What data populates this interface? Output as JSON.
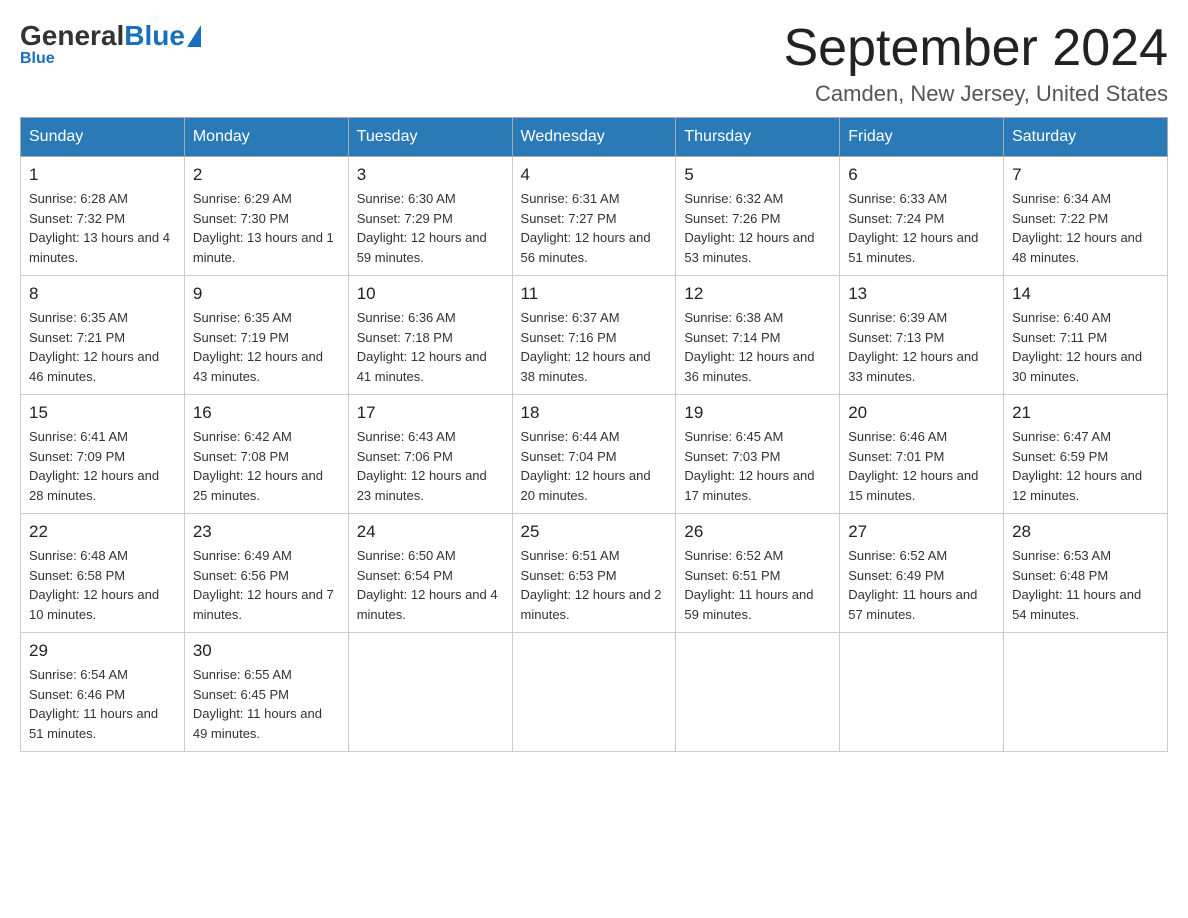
{
  "header": {
    "logo": {
      "general": "General",
      "blue": "Blue",
      "subtitle": "Blue"
    },
    "title": "September 2024",
    "subtitle": "Camden, New Jersey, United States"
  },
  "calendar": {
    "days_of_week": [
      "Sunday",
      "Monday",
      "Tuesday",
      "Wednesday",
      "Thursday",
      "Friday",
      "Saturday"
    ],
    "weeks": [
      [
        {
          "day": "1",
          "sunrise": "6:28 AM",
          "sunset": "7:32 PM",
          "daylight": "13 hours and 4 minutes."
        },
        {
          "day": "2",
          "sunrise": "6:29 AM",
          "sunset": "7:30 PM",
          "daylight": "13 hours and 1 minute."
        },
        {
          "day": "3",
          "sunrise": "6:30 AM",
          "sunset": "7:29 PM",
          "daylight": "12 hours and 59 minutes."
        },
        {
          "day": "4",
          "sunrise": "6:31 AM",
          "sunset": "7:27 PM",
          "daylight": "12 hours and 56 minutes."
        },
        {
          "day": "5",
          "sunrise": "6:32 AM",
          "sunset": "7:26 PM",
          "daylight": "12 hours and 53 minutes."
        },
        {
          "day": "6",
          "sunrise": "6:33 AM",
          "sunset": "7:24 PM",
          "daylight": "12 hours and 51 minutes."
        },
        {
          "day": "7",
          "sunrise": "6:34 AM",
          "sunset": "7:22 PM",
          "daylight": "12 hours and 48 minutes."
        }
      ],
      [
        {
          "day": "8",
          "sunrise": "6:35 AM",
          "sunset": "7:21 PM",
          "daylight": "12 hours and 46 minutes."
        },
        {
          "day": "9",
          "sunrise": "6:35 AM",
          "sunset": "7:19 PM",
          "daylight": "12 hours and 43 minutes."
        },
        {
          "day": "10",
          "sunrise": "6:36 AM",
          "sunset": "7:18 PM",
          "daylight": "12 hours and 41 minutes."
        },
        {
          "day": "11",
          "sunrise": "6:37 AM",
          "sunset": "7:16 PM",
          "daylight": "12 hours and 38 minutes."
        },
        {
          "day": "12",
          "sunrise": "6:38 AM",
          "sunset": "7:14 PM",
          "daylight": "12 hours and 36 minutes."
        },
        {
          "day": "13",
          "sunrise": "6:39 AM",
          "sunset": "7:13 PM",
          "daylight": "12 hours and 33 minutes."
        },
        {
          "day": "14",
          "sunrise": "6:40 AM",
          "sunset": "7:11 PM",
          "daylight": "12 hours and 30 minutes."
        }
      ],
      [
        {
          "day": "15",
          "sunrise": "6:41 AM",
          "sunset": "7:09 PM",
          "daylight": "12 hours and 28 minutes."
        },
        {
          "day": "16",
          "sunrise": "6:42 AM",
          "sunset": "7:08 PM",
          "daylight": "12 hours and 25 minutes."
        },
        {
          "day": "17",
          "sunrise": "6:43 AM",
          "sunset": "7:06 PM",
          "daylight": "12 hours and 23 minutes."
        },
        {
          "day": "18",
          "sunrise": "6:44 AM",
          "sunset": "7:04 PM",
          "daylight": "12 hours and 20 minutes."
        },
        {
          "day": "19",
          "sunrise": "6:45 AM",
          "sunset": "7:03 PM",
          "daylight": "12 hours and 17 minutes."
        },
        {
          "day": "20",
          "sunrise": "6:46 AM",
          "sunset": "7:01 PM",
          "daylight": "12 hours and 15 minutes."
        },
        {
          "day": "21",
          "sunrise": "6:47 AM",
          "sunset": "6:59 PM",
          "daylight": "12 hours and 12 minutes."
        }
      ],
      [
        {
          "day": "22",
          "sunrise": "6:48 AM",
          "sunset": "6:58 PM",
          "daylight": "12 hours and 10 minutes."
        },
        {
          "day": "23",
          "sunrise": "6:49 AM",
          "sunset": "6:56 PM",
          "daylight": "12 hours and 7 minutes."
        },
        {
          "day": "24",
          "sunrise": "6:50 AM",
          "sunset": "6:54 PM",
          "daylight": "12 hours and 4 minutes."
        },
        {
          "day": "25",
          "sunrise": "6:51 AM",
          "sunset": "6:53 PM",
          "daylight": "12 hours and 2 minutes."
        },
        {
          "day": "26",
          "sunrise": "6:52 AM",
          "sunset": "6:51 PM",
          "daylight": "11 hours and 59 minutes."
        },
        {
          "day": "27",
          "sunrise": "6:52 AM",
          "sunset": "6:49 PM",
          "daylight": "11 hours and 57 minutes."
        },
        {
          "day": "28",
          "sunrise": "6:53 AM",
          "sunset": "6:48 PM",
          "daylight": "11 hours and 54 minutes."
        }
      ],
      [
        {
          "day": "29",
          "sunrise": "6:54 AM",
          "sunset": "6:46 PM",
          "daylight": "11 hours and 51 minutes."
        },
        {
          "day": "30",
          "sunrise": "6:55 AM",
          "sunset": "6:45 PM",
          "daylight": "11 hours and 49 minutes."
        },
        null,
        null,
        null,
        null,
        null
      ]
    ]
  }
}
